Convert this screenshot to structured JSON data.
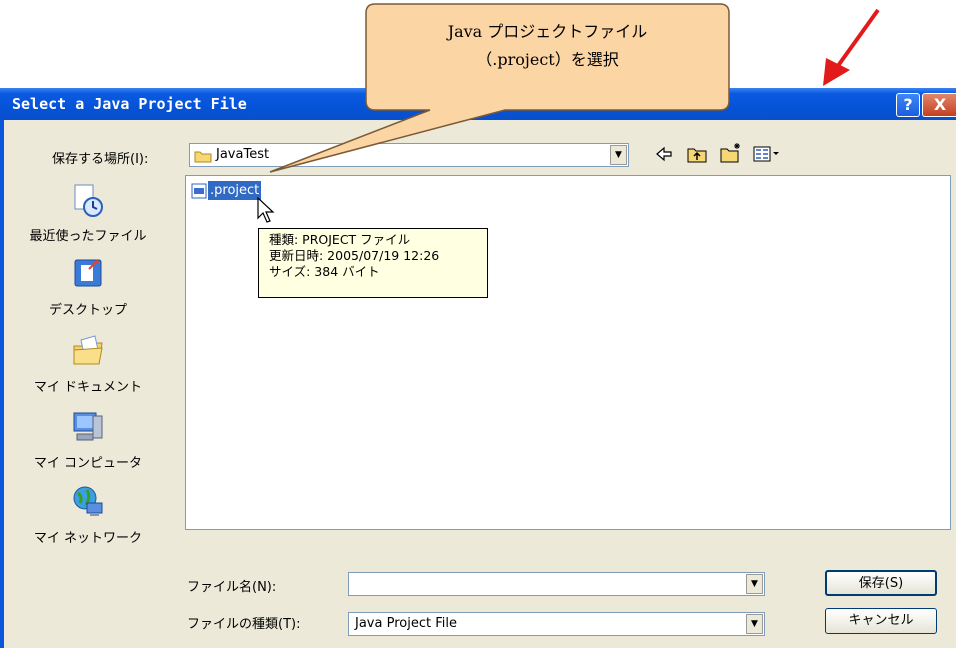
{
  "dialog": {
    "title": "Select a Java Project File",
    "help_label": "?",
    "close_label": "X"
  },
  "toolbar": {
    "location_label": "保存する場所(I):",
    "location_value": "JavaTest"
  },
  "places": [
    {
      "label": "最近使ったファイル",
      "icon": "recent-files-icon"
    },
    {
      "label": "デスクトップ",
      "icon": "desktop-icon"
    },
    {
      "label": "マイ ドキュメント",
      "icon": "my-documents-icon"
    },
    {
      "label": "マイ コンピュータ",
      "icon": "my-computer-icon"
    },
    {
      "label": "マイ ネットワーク",
      "icon": "my-network-icon"
    }
  ],
  "file_list": {
    "files": [
      ".project"
    ]
  },
  "tooltip": {
    "line1": "種類: PROJECT ファイル",
    "line2": "更新日時: 2005/07/19 12:26",
    "line3": "サイズ: 384 バイト"
  },
  "form": {
    "filename_label": "ファイル名(N):",
    "filename_value": "",
    "filetype_label": "ファイルの種類(T):",
    "filetype_value": "Java Project File",
    "save_label": "保存(S)",
    "cancel_label": "キャンセル"
  },
  "callout": {
    "line1": "Java プロジェクトファイル",
    "line2": "（.project）を選択"
  },
  "colors": {
    "title_bar": "#0553d8",
    "dialog_bg": "#ece9d8",
    "callout_fill": "#fcd5a4",
    "arrow": "#e31a1a"
  }
}
